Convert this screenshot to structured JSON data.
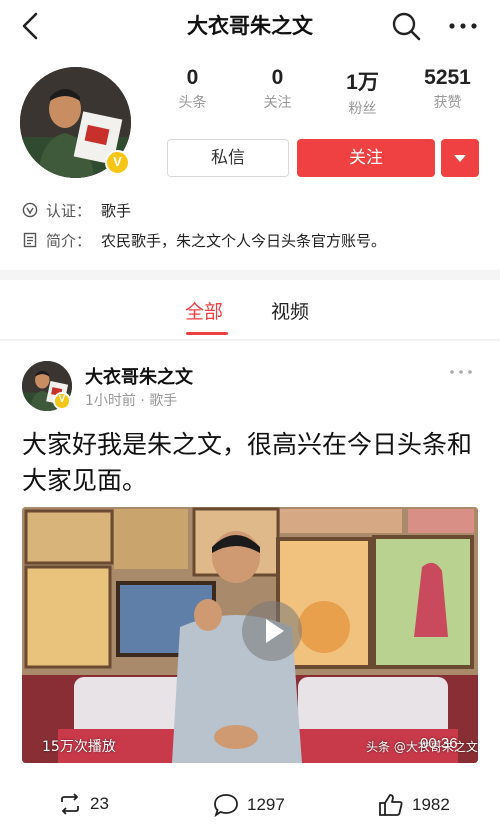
{
  "header": {
    "title": "大衣哥朱之文"
  },
  "profile": {
    "verified_badge": "V",
    "stats": [
      {
        "value": "0",
        "label": "头条"
      },
      {
        "value": "0",
        "label": "关注"
      },
      {
        "value": "1万",
        "label": "粉丝"
      },
      {
        "value": "5251",
        "label": "获赞"
      }
    ],
    "message_button": "私信",
    "follow_button": "关注",
    "certification_key": "认证：",
    "certification_value": "歌手",
    "intro_key": "简介：",
    "intro_value": "农民歌手，朱之文个人今日头条官方账号。"
  },
  "tabs": [
    {
      "label": "全部",
      "active": true
    },
    {
      "label": "视频",
      "active": false
    }
  ],
  "post": {
    "author": "大衣哥朱之文",
    "meta": "1小时前 · 歌手",
    "text": "大家好我是朱之文，很高兴在今日头条和大家见面。",
    "video": {
      "views": "15万次播放",
      "watermark": "头条 @大衣哥朱之文",
      "duration": "00:36"
    },
    "actions": {
      "repost_count": "23",
      "comment_count": "1297",
      "like_count": "1982"
    }
  },
  "colors": {
    "accent": "#f04142",
    "badge": "#f5c518",
    "muted_text": "#999999",
    "background": "#f5f5f5"
  },
  "icons": [
    "back-arrow-icon",
    "search-icon",
    "more-icon",
    "verified-icon",
    "certification-icon",
    "intro-icon",
    "play-icon",
    "repost-icon",
    "comment-icon",
    "like-icon"
  ]
}
